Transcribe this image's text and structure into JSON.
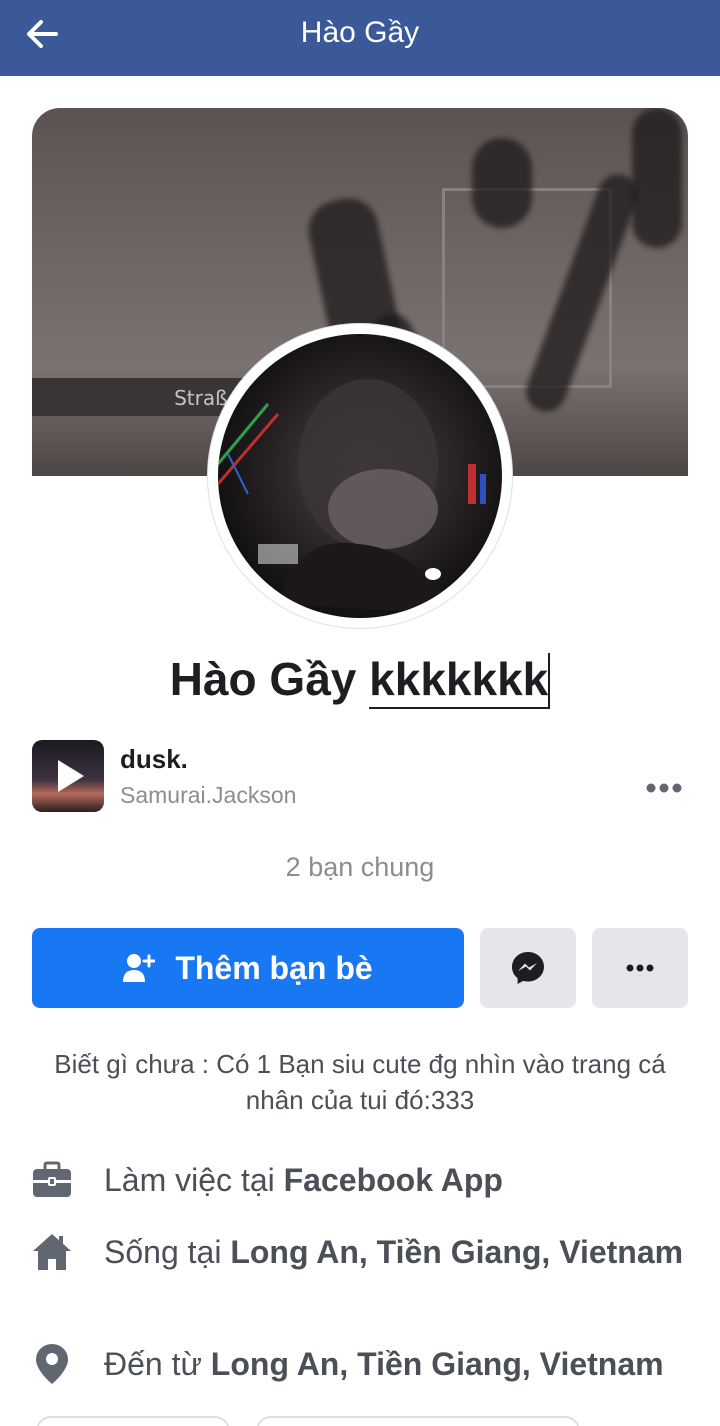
{
  "header": {
    "title": "Hào Gầy"
  },
  "cover": {
    "sign_text": "Straße"
  },
  "profile": {
    "name": "Hào Gầy",
    "nickname": "kkkkkkk"
  },
  "music": {
    "title": "dusk.",
    "artist": "Samurai.Jackson"
  },
  "mutual_friends": "2 bạn chung",
  "actions": {
    "add_friend_label": "Thêm bạn bè"
  },
  "bio": "Biết gì chưa : Có 1 Bạn siu cute đg nhìn vào trang cá nhân của tui đó:333",
  "details": [
    {
      "prefix": "Làm việc tại",
      "value": "Facebook App",
      "icon": "briefcase-icon"
    },
    {
      "prefix": "Sống tại",
      "value": "Long An, Tiền Giang, Vietnam",
      "icon": "home-icon"
    },
    {
      "prefix": "Đến từ",
      "value": "Long An, Tiền Giang, Vietnam",
      "icon": "location-pin-icon"
    }
  ],
  "colors": {
    "header_bg": "#3b5998",
    "primary_button": "#1877f2",
    "secondary_button": "#e4e6eb",
    "muted_text": "#8a8d91"
  }
}
